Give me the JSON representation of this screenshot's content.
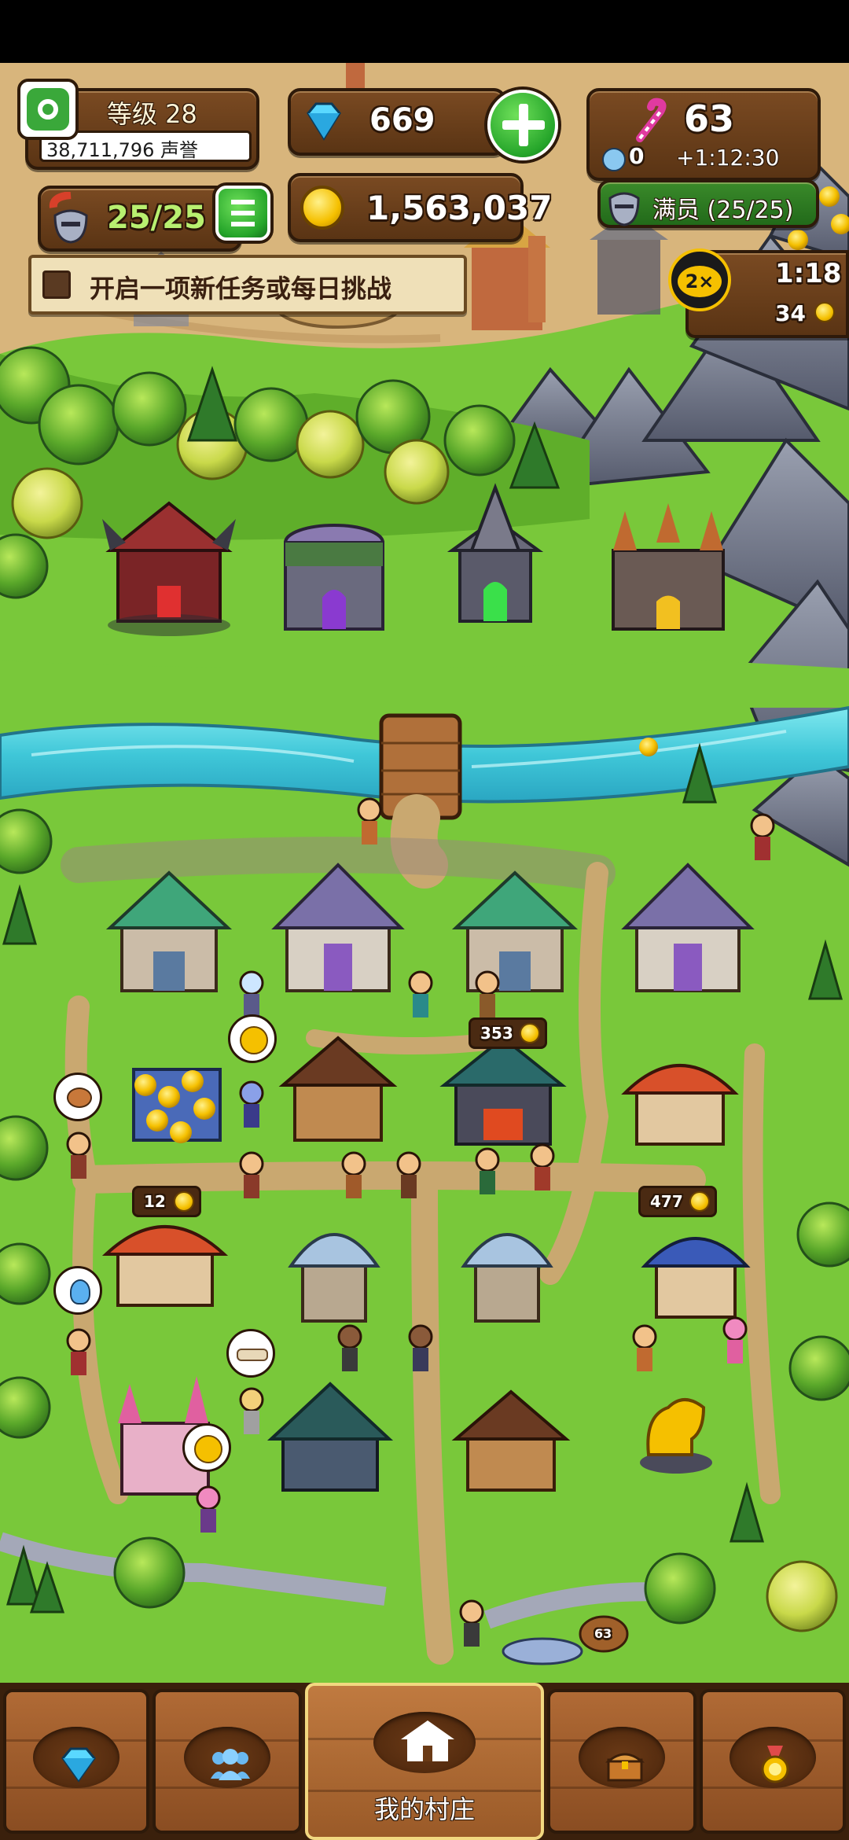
{
  "hud": {
    "level_label": "等级 28",
    "reputation": "38,711,796 声誉",
    "gems": "669",
    "candy": "63",
    "unicorn_count": "0",
    "timer": "+1:12:30",
    "heroes": "25/25",
    "gold": "1,563,037",
    "roster_status": "满员 (25/25)",
    "quest_prompt": "开启一项新任务或每日挑战",
    "boost_multiplier": "2×",
    "boost_timer": "1:18",
    "boost_coins": "34"
  },
  "map_labels": {
    "forge_income": "353",
    "tavern_income": "12",
    "house_income": "477",
    "basket_count": "63"
  },
  "nav": {
    "tabs": [
      {
        "label": "",
        "icon": "gem-icon"
      },
      {
        "label": "",
        "icon": "heroes-icon"
      },
      {
        "label": "我的村庄",
        "icon": "village-icon"
      },
      {
        "label": "",
        "icon": "treasure-chest-icon"
      },
      {
        "label": "",
        "icon": "medal-icon"
      }
    ]
  },
  "colors": {
    "grass": "#79c83a",
    "river": "#3fc7d8",
    "path": "#c9a870",
    "wood_panel": "#6a3e18",
    "accent_green": "#2db52f"
  }
}
